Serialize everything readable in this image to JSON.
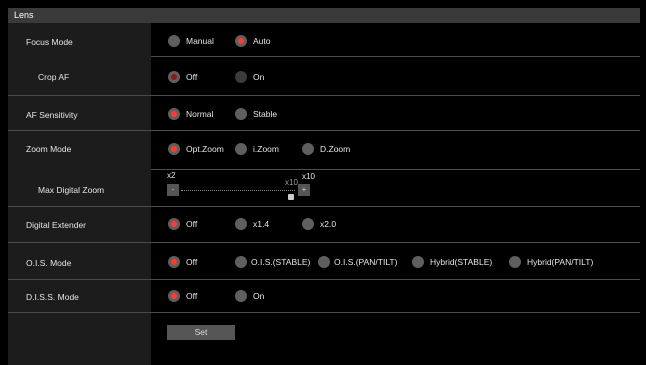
{
  "header": {
    "title": "Lens"
  },
  "focus_mode": {
    "label": "Focus Mode",
    "options": [
      "Manual",
      "Auto"
    ],
    "selected": "Auto"
  },
  "crop_af": {
    "label": "Crop AF",
    "options": [
      "Off",
      "On"
    ],
    "selected": "Off"
  },
  "af_sensitivity": {
    "label": "AF Sensitivity",
    "options": [
      "Normal",
      "Stable"
    ],
    "selected": "Normal"
  },
  "zoom_mode": {
    "label": "Zoom Mode",
    "options": [
      "Opt.Zoom",
      "i.Zoom",
      "D.Zoom"
    ],
    "selected": "Opt.Zoom"
  },
  "max_digital_zoom": {
    "label": "Max Digital Zoom",
    "min_label": "x2",
    "max_label": "x10",
    "current_label": "x10",
    "decrement": "-",
    "increment": "+",
    "value": 10
  },
  "digital_extender": {
    "label": "Digital Extender",
    "options": [
      "Off",
      "x1.4",
      "x2.0"
    ],
    "selected": "Off"
  },
  "ois_mode": {
    "label": "O.I.S. Mode",
    "options": [
      "Off",
      "O.I.S.(STABLE)",
      "O.I.S.(PAN/TILT)",
      "Hybrid(STABLE)",
      "Hybrid(PAN/TILT)"
    ],
    "selected": "Off"
  },
  "diss_mode": {
    "label": "D.I.S.S. Mode",
    "options": [
      "Off",
      "On"
    ],
    "selected": "Off"
  },
  "set_button": {
    "label": "Set"
  },
  "colors": {
    "accent": "#ff3b2f",
    "radio_off": "#5f5f5f",
    "header_bg": "#3a3a3a",
    "label_col_bg": "#1c1c1c"
  }
}
